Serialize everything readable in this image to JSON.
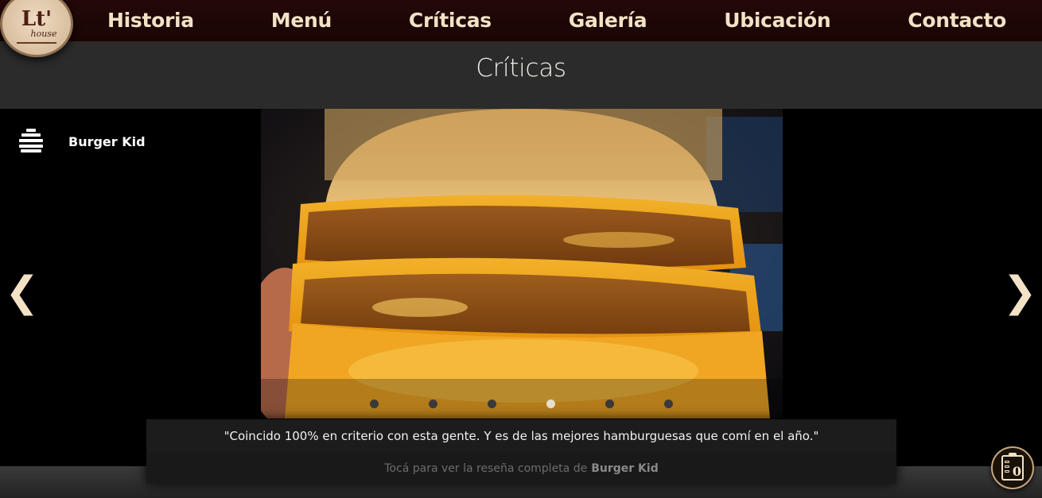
{
  "nav": {
    "logo_main": "Lt'",
    "logo_sub": "house",
    "links": [
      "Historia",
      "Menú",
      "Críticas",
      "Galería",
      "Ubicación",
      "Contacto"
    ]
  },
  "section": {
    "title": "Críticas"
  },
  "slider": {
    "reviewer_name": "Burger Kid",
    "reviewer_icon": "burger-icon",
    "prev_arrow": "❮",
    "next_arrow": "❯",
    "slide_count": 6,
    "active_slide": 4
  },
  "review": {
    "quote": "\"Coincido 100% en criterio con esta gente. Y es de las mejores hamburguesas que comí en el año.\"",
    "link_prefix": "Tocá para ver la reseña completa de",
    "link_reviewer": "Burger Kid"
  },
  "order": {
    "count": "0",
    "icon": "clipboard-icon"
  },
  "colors": {
    "accent": "#f3e2c6",
    "nav_bg": "#240808",
    "header_bg": "#2b2b2b"
  }
}
